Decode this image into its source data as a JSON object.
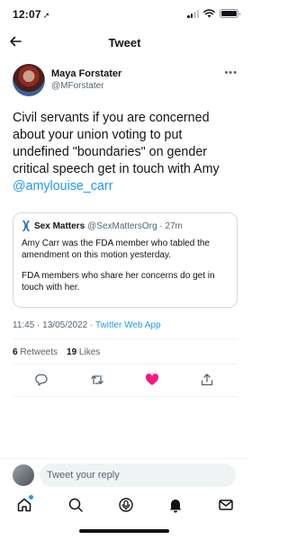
{
  "status_bar": {
    "time": "12:07",
    "location_arrow": "➚"
  },
  "header": {
    "title": "Tweet"
  },
  "author": {
    "name": "Maya Forstater",
    "handle": "@MForstater",
    "more": "•••"
  },
  "tweet": {
    "text": "Civil servants if you are concerned about your union voting to put undefined \"boundaries\" on gender critical speech get in touch with Amy ",
    "mention": "@amylouise_carr"
  },
  "quote": {
    "name": "Sex Matters",
    "handle": "@SexMattersOrg · 27m",
    "paragraphs": [
      "Amy Carr was the FDA member who tabled the amendment on this motion yesterday.",
      "FDA members who share her concerns do get in touch with her."
    ]
  },
  "meta": {
    "time": "11:45 · 13/05/2022 · ",
    "source": "Twitter Web App"
  },
  "stats": {
    "retweets_count": "6",
    "retweets_label": " Retweets",
    "likes_count": "19",
    "likes_label": " Likes"
  },
  "reply": {
    "placeholder": "Tweet your reply"
  },
  "colors": {
    "accent": "#1d9bf0",
    "like": "#f91880",
    "text": "#0f1419",
    "muted": "#536471"
  },
  "icons": {
    "back": "arrow-left-icon",
    "actions": [
      "reply-icon",
      "retweet-icon",
      "like-icon",
      "share-icon"
    ],
    "tabs": [
      "home-icon",
      "search-icon",
      "spaces-icon",
      "notifications-icon",
      "messages-icon"
    ]
  }
}
